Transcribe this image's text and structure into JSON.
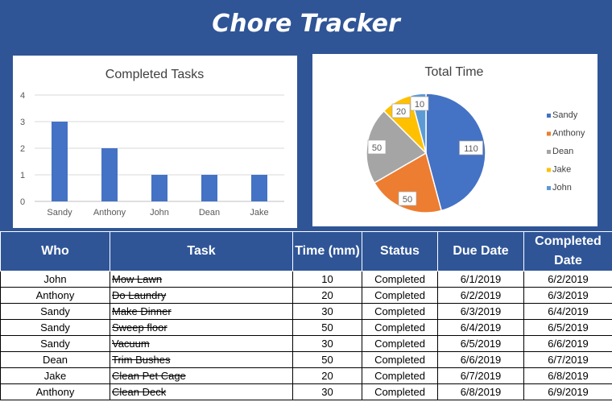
{
  "header": {
    "title": "Chore Tracker"
  },
  "colors": {
    "banner": "#2f5597",
    "bar": "#4472c4",
    "sandy": "#4472c4",
    "anthony": "#ed7d31",
    "dean": "#a5a5a5",
    "jake": "#ffc000",
    "john": "#5b9bd5"
  },
  "chart_data": [
    {
      "type": "bar",
      "title": "Completed Tasks",
      "categories": [
        "Sandy",
        "Anthony",
        "John",
        "Dean",
        "Jake"
      ],
      "values": [
        3,
        2,
        1,
        1,
        1
      ],
      "ylim": [
        0,
        4
      ],
      "yticks": [
        "0",
        "1",
        "2",
        "3",
        "4"
      ],
      "grid": true,
      "xlabel": "",
      "ylabel": ""
    },
    {
      "type": "pie",
      "title": "Total Time",
      "categories": [
        "Sandy",
        "Anthony",
        "Dean",
        "Jake",
        "John"
      ],
      "values": [
        110,
        50,
        50,
        20,
        10
      ],
      "value_labels": [
        "110",
        "50",
        "50",
        "20",
        "10"
      ],
      "legend": "right"
    }
  ],
  "table": {
    "headers": [
      "Who",
      "Task",
      "Time (mm)",
      "Status",
      "Due Date",
      "Completed Date"
    ],
    "rows": [
      [
        "John",
        "Mow Lawn",
        "10",
        "Completed",
        "6/1/2019",
        "6/2/2019"
      ],
      [
        "Anthony",
        "Do Laundry",
        "20",
        "Completed",
        "6/2/2019",
        "6/3/2019"
      ],
      [
        "Sandy",
        "Make Dinner",
        "30",
        "Completed",
        "6/3/2019",
        "6/4/2019"
      ],
      [
        "Sandy",
        "Sweep floor",
        "50",
        "Completed",
        "6/4/2019",
        "6/5/2019"
      ],
      [
        "Sandy",
        "Vacuum",
        "30",
        "Completed",
        "6/5/2019",
        "6/6/2019"
      ],
      [
        "Dean",
        "Trim Bushes",
        "50",
        "Completed",
        "6/6/2019",
        "6/7/2019"
      ],
      [
        "Jake",
        "Clean Pet Cage",
        "20",
        "Completed",
        "6/7/2019",
        "6/8/2019"
      ],
      [
        "Anthony",
        "Clean Deck",
        "30",
        "Completed",
        "6/8/2019",
        "6/9/2019"
      ]
    ]
  }
}
